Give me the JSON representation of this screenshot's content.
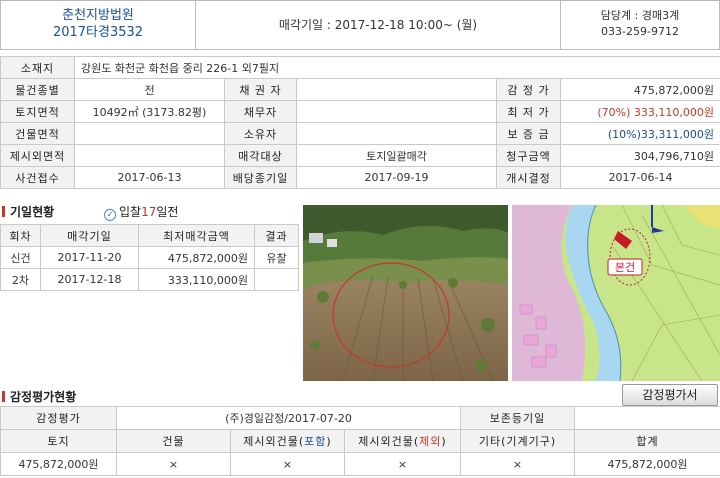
{
  "header": {
    "court": "춘천지방법원",
    "case_no": "2017타경3532",
    "sale_date_label": "매각기일 : 2017-12-18   10:00~ (월)",
    "dept": "담당계 : 경매3계",
    "phone": "033-259-9712"
  },
  "info": {
    "location_label": "소재지",
    "location": "강원도 화천군 화천읍 중리 226-1 외7필지",
    "rows": [
      {
        "l1": "물건종별",
        "v1": "전",
        "l2": "채 권 자",
        "v2": "",
        "l3": "감 정 가",
        "v3": "475,872,000원"
      },
      {
        "l1": "토지면적",
        "v1": "10492㎡ (3173.82평)",
        "l2": "채무자",
        "v2": "",
        "l3": "최 저 가",
        "v3": "(70%) 333,110,000원"
      },
      {
        "l1": "건물면적",
        "v1": "",
        "l2": "소유자",
        "v2": "",
        "l3": "보 증 금",
        "v3": "(10%)33,311,000원"
      },
      {
        "l1": "제시외면적",
        "v1": "",
        "l2": "매각대상",
        "v2": "토지일괄매각",
        "l3": "청구금액",
        "v3": "304,796,710원"
      },
      {
        "l1": "사건접수",
        "v1": "2017-06-13",
        "l2": "배당종기일",
        "v2": "2017-09-19",
        "l3": "개시결정",
        "v3": "2017-06-14"
      }
    ]
  },
  "history": {
    "title": "기일현황",
    "bid_note_prefix": "입찰",
    "bid_note_num": "17",
    "bid_note_suffix": "일전",
    "columns": [
      "회차",
      "매각기일",
      "최저매각금액",
      "결과"
    ],
    "rows": [
      [
        "신건",
        "2017-11-20",
        "475,872,000원",
        "유찰"
      ],
      [
        "2차",
        "2017-12-18",
        "333,110,000원",
        ""
      ]
    ]
  },
  "map": {
    "marker": "본건"
  },
  "appraisal": {
    "title": "감정평가현황",
    "button": "감정평가서",
    "r1": [
      "감정평가",
      "(주)경일감정/2017-07-20",
      "보존등기일",
      ""
    ],
    "headers": {
      "land": "토지",
      "building": "건물",
      "incl_prefix": "제시외건물(",
      "incl_word": "포함",
      "excl_prefix": "제시외건물(",
      "excl_word": "제외",
      "close": ")",
      "other": "기타(기계기구)",
      "total": "합계"
    },
    "values": [
      "475,872,000원",
      "×",
      "×",
      "×",
      "×",
      "475,872,000원"
    ]
  }
}
